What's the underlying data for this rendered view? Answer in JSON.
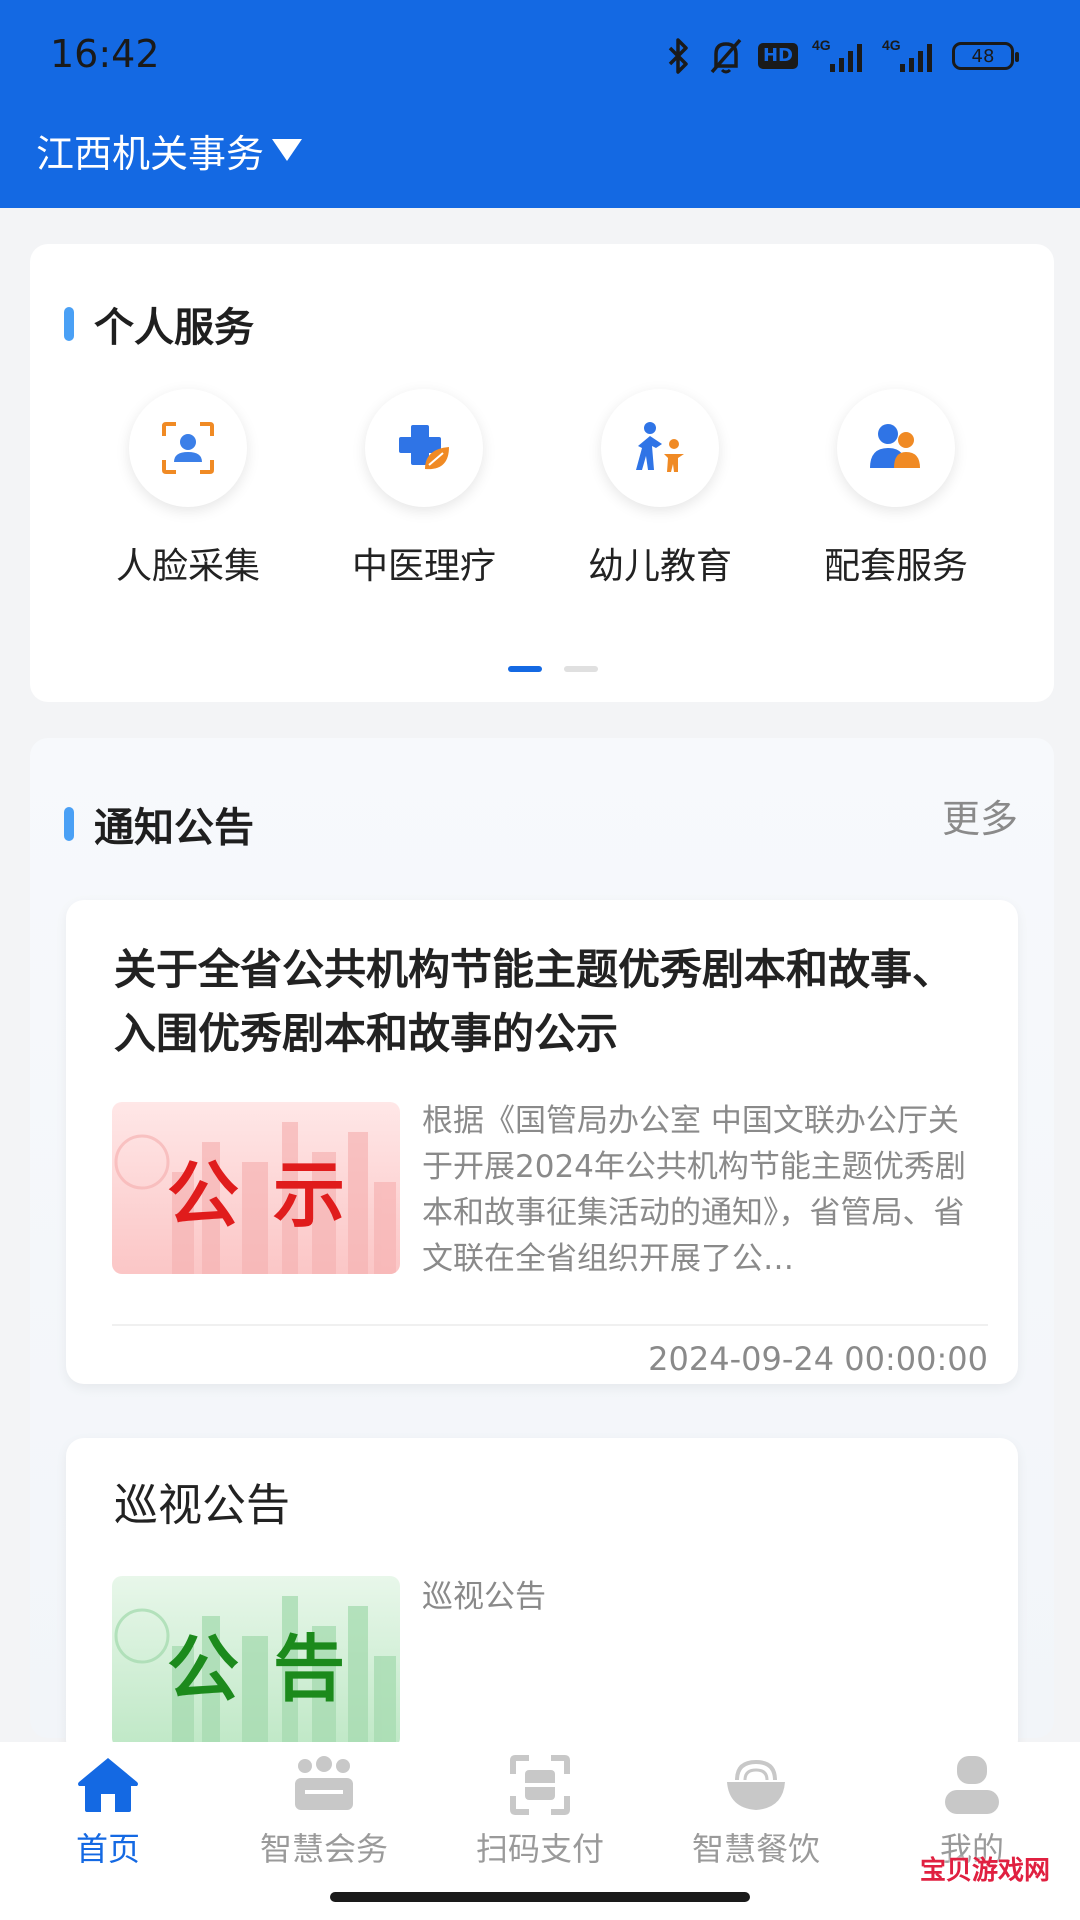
{
  "status_bar": {
    "time": "16:42",
    "hd": "HD",
    "net1": "4G",
    "net2": "4G",
    "battery": "48"
  },
  "app": {
    "title": "江西机关事务"
  },
  "personal_services": {
    "heading": "个人服务",
    "items": [
      {
        "label": "人脸采集",
        "icon": "face-scan-icon"
      },
      {
        "label": "中医理疗",
        "icon": "medical-cross-leaf-icon"
      },
      {
        "label": "幼儿教育",
        "icon": "parent-child-icon"
      },
      {
        "label": "配套服务",
        "icon": "people-service-icon"
      }
    ],
    "pager": {
      "pages": 2,
      "active": 1
    }
  },
  "notices": {
    "heading": "通知公告",
    "more": "更多",
    "items": [
      {
        "title": "关于全省公共机构节能主题优秀剧本和故事、入围优秀剧本和故事的公示",
        "thumb_text": "公示",
        "summary": "根据《国管局办公室 中国文联办公厅关于开展2024年公共机构节能主题优秀剧本和故事征集活动的通知》，省管局、省文联在全省组织开展了公…",
        "date": "2024-09-24 00:00:00"
      },
      {
        "title": "巡视公告",
        "thumb_text": "公告",
        "summary": "巡视公告"
      }
    ]
  },
  "tabbar": {
    "tabs": [
      {
        "label": "首页",
        "icon": "home-icon",
        "active": true
      },
      {
        "label": "智慧会务",
        "icon": "meeting-icon"
      },
      {
        "label": "扫码支付",
        "icon": "scan-icon"
      },
      {
        "label": "智慧餐饮",
        "icon": "dining-bowl-icon"
      },
      {
        "label": "我的",
        "icon": "profile-icon"
      }
    ]
  },
  "watermark": "宝贝游戏网",
  "colors": {
    "primary": "#1469e3",
    "accent_bar": "#4aa0f5",
    "red_badge": "#e01c1c",
    "green_badge": "#1c8a1c"
  }
}
